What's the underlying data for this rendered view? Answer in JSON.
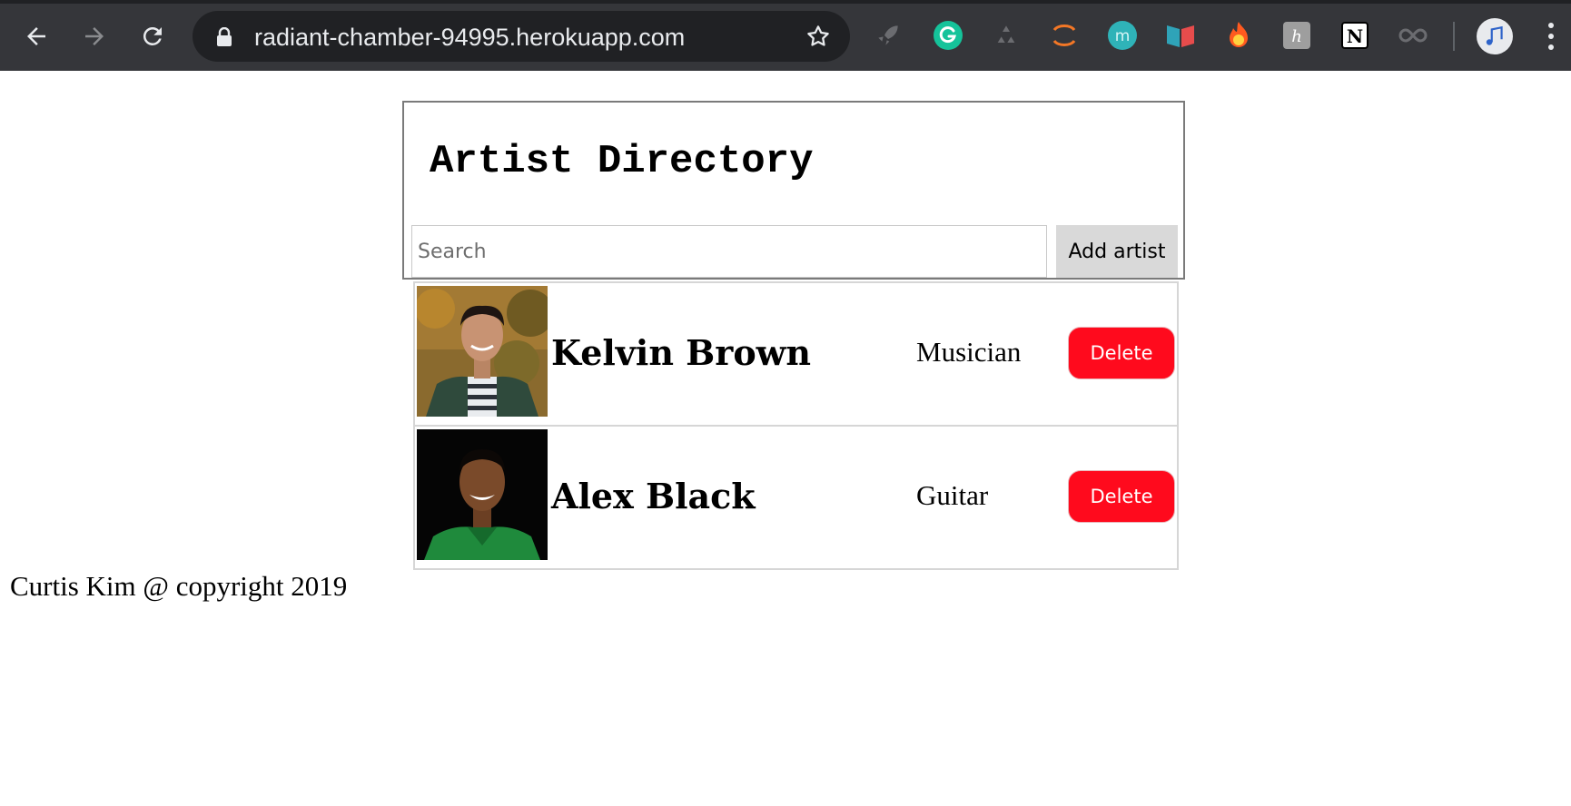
{
  "browser": {
    "url": "radiant-chamber-94995.herokuapp.com",
    "icons": {
      "back": "arrow-left-icon",
      "forward": "arrow-right-icon",
      "reload": "reload-icon",
      "secure": "lock-icon",
      "bookmark": "star-icon",
      "extensions": [
        "rocket-icon",
        "grammarly-icon",
        "recycle-icon",
        "jupyter-icon",
        "m-icon",
        "split-icon",
        "fire-icon",
        "h-icon",
        "notion-icon",
        "infinity-icon"
      ],
      "profile": "music-note-icon",
      "menu": "more-vert-icon"
    },
    "colors": {
      "frame": "#35363a",
      "omnibox": "#202124",
      "text": "#e8eaed"
    }
  },
  "page": {
    "title": "Artist Directory",
    "search": {
      "placeholder": "Search",
      "value": ""
    },
    "add_button": "Add artist",
    "artists": [
      {
        "name": "Kelvin Brown",
        "role": "Musician",
        "delete_label": "Delete"
      },
      {
        "name": "Alex Black",
        "role": "Guitar",
        "delete_label": "Delete"
      }
    ],
    "footer": "Curtis Kim @ copyright 2019",
    "colors": {
      "delete": "#ff0a1d",
      "add": "#d9d9d9"
    }
  }
}
